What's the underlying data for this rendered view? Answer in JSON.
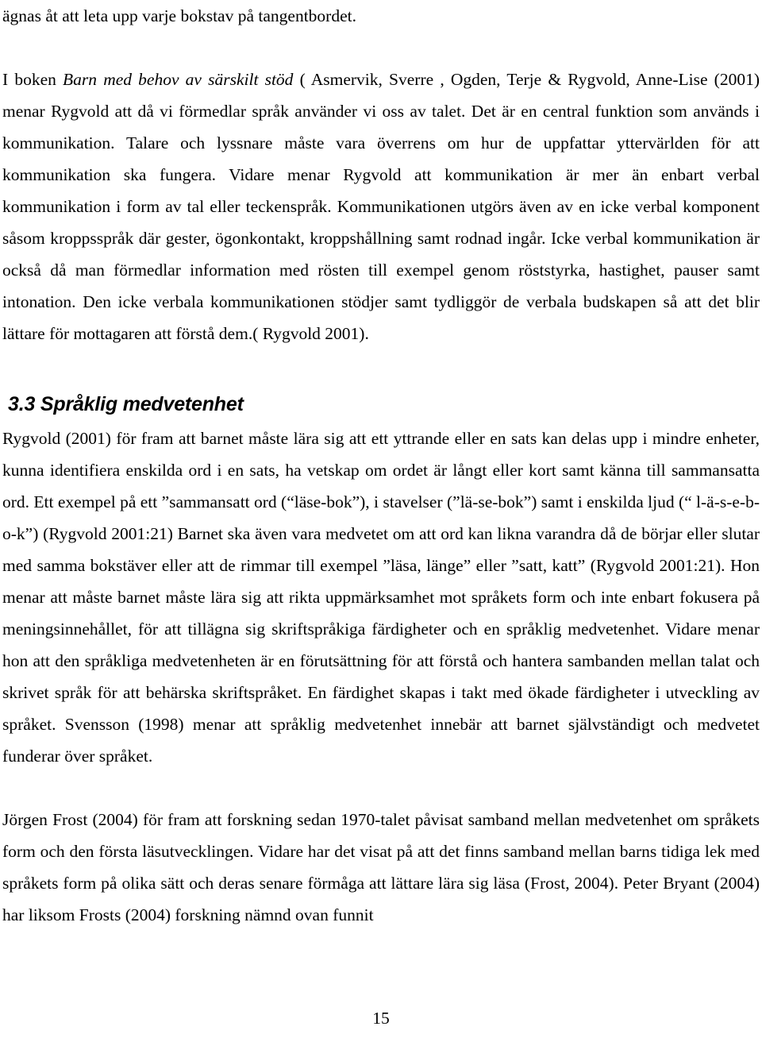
{
  "document": {
    "page_number": "15",
    "language": "sv"
  },
  "content": {
    "continuation_line": "ägnas åt att leta upp varje bokstav på tangentbordet.",
    "paragraph_1": {
      "before_title": "I boken ",
      "book_title": "Barn med behov av särskilt stöd",
      "after_title": " ( Asmervik, Sverre , Ogden, Terje & Rygvold, Anne-Lise (2001) menar Rygvold  att då vi förmedlar språk använder vi oss av talet. Det är en central funktion som används i kommunikation. Talare och lyssnare måste vara överrens om hur de uppfattar yttervärlden för att kommunikation ska fungera. Vidare menar Rygvold att kommunikation är mer än enbart verbal kommunikation i form av tal eller teckenspråk. Kommunikationen utgörs även av en icke verbal komponent såsom kroppsspråk där gester, ögonkontakt, kroppshållning samt rodnad ingår. Icke verbal kommunikation är också då man förmedlar information med rösten till exempel genom röststyrka, hastighet, pauser samt intonation. Den icke verbala kommunikationen stödjer samt tydliggör de verbala budskapen så att det blir lättare för mottagaren att förstå dem.( Rygvold  2001)."
    },
    "heading_3_3": "3.3 Språklig medvetenhet",
    "paragraph_2": " Rygvold (2001) för fram att barnet måste lära sig att ett yttrande eller en sats kan delas upp i mindre enheter, kunna identifiera enskilda ord i en sats, ha vetskap om ordet är långt eller kort samt känna till sammansatta ord. Ett exempel på ett ”sammansatt ord (“läse-bok”), i stavelser (”lä-se-bok”) samt i enskilda ljud (“ l-ä-s-e-b-o-k”) (Rygvold 2001:21) Barnet ska även vara medvetet om att ord kan likna varandra då de börjar eller slutar med samma bokstäver eller att de rimmar till exempel ”läsa, länge” eller ”satt, katt” (Rygvold 2001:21). Hon menar att måste barnet måste lära sig att rikta uppmärksamhet mot språkets form och inte enbart fokusera på meningsinnehållet, för att tillägna sig skriftspråkiga färdigheter och en språklig medvetenhet. Vidare menar hon att den språkliga medvetenheten är en förutsättning för att förstå och hantera sambanden mellan talat och skrivet språk för att behärska skriftspråket. En färdighet skapas i takt med ökade färdigheter i utveckling av språket. Svensson (1998) menar att språklig medvetenhet innebär att barnet självständigt och medvetet funderar över språket.",
    "paragraph_3": "Jörgen Frost (2004) för fram att forskning sedan 1970-talet påvisat samband mellan medvetenhet om språkets form och den första läsutvecklingen. Vidare har det visat på att det finns samband mellan barns tidiga lek med språkets form på olika sätt och deras senare förmåga att lättare lära sig läsa (Frost, 2004). Peter Bryant (2004) har liksom Frosts (2004) forskning nämnd ovan funnit"
  }
}
